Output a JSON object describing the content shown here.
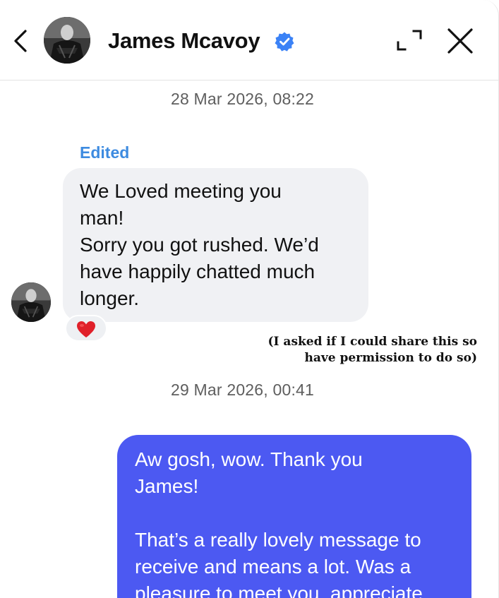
{
  "header": {
    "contact_name": "James Mcavoy",
    "verified": true,
    "icons": {
      "back": "chevron-left-icon",
      "expand": "expand-icon",
      "close": "close-icon",
      "verified": "verified-badge-icon"
    }
  },
  "conversation": {
    "timestamp_1": "28 Mar 2026, 08:22",
    "edited_label": "Edited",
    "incoming_message": {
      "lines": [
        "We Loved meeting you",
        "man!",
        "Sorry you got rushed. We’d",
        "have happily chatted much",
        "longer."
      ],
      "reaction": "❤️"
    },
    "caption": {
      "lines": [
        "(I asked if I could share this so",
        "have permission to do so)"
      ]
    },
    "timestamp_2": "29 Mar 2026, 00:41",
    "outgoing_message": {
      "lines": [
        "Aw gosh, wow. Thank you",
        "James!",
        "",
        "That’s a really lovely message to",
        "receive and means a lot. Was a",
        "pleasure to meet you, appreciate"
      ]
    }
  },
  "colors": {
    "outgoing_bubble": "#4c59f2",
    "incoming_bubble": "#f0f1f4",
    "verified_badge": "#3b82f6",
    "edited_label": "#3d8be0"
  }
}
